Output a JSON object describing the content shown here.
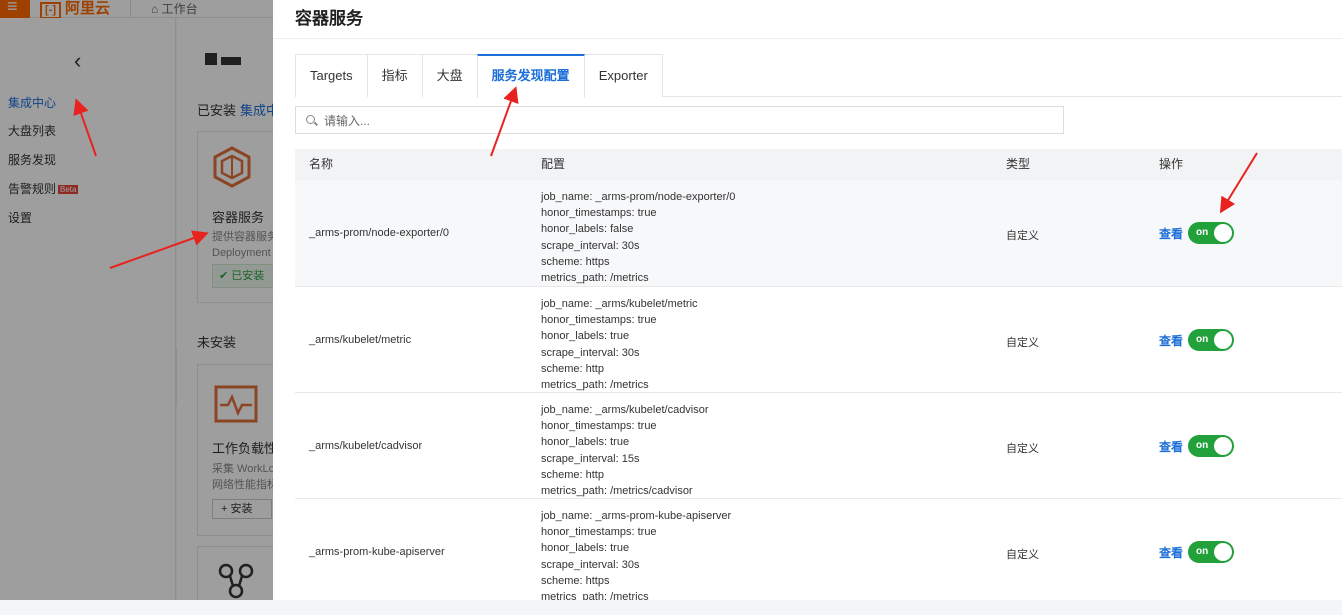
{
  "topbar": {
    "logo_text": "阿里云",
    "logo_mark": "[-]",
    "workbench": "⌂ 工作台"
  },
  "leftnav": {
    "items": [
      {
        "label": "集成中心",
        "active": true
      },
      {
        "label": "大盘列表"
      },
      {
        "label": "服务发现"
      },
      {
        "label": "告警规则",
        "badge": "Beta"
      },
      {
        "label": "设置"
      }
    ]
  },
  "center": {
    "installed_title": "已安装",
    "installed_link": "集成中",
    "uninstalled_title": "未安装",
    "card_container": {
      "name": "容器服务",
      "desc_line1": "提供容器服务",
      "desc_line2": "Deployment",
      "status": "✔ 已安装"
    },
    "card_workload": {
      "name": "工作负载性",
      "desc_line1": "采集 WorkLo",
      "desc_line2": "网络性能指标",
      "install": "+ 安装"
    }
  },
  "drawer": {
    "title": "容器服务",
    "tabs": [
      {
        "label": "Targets"
      },
      {
        "label": "指标"
      },
      {
        "label": "大盘"
      },
      {
        "label": "服务发现配置",
        "active": true
      },
      {
        "label": "Exporter"
      }
    ],
    "search_placeholder": "请输入...",
    "table": {
      "headers": {
        "name": "名称",
        "config": "配置",
        "type": "类型",
        "action": "操作"
      },
      "rows": [
        {
          "name": "_arms-prom/node-exporter/0",
          "config": [
            "job_name: _arms-prom/node-exporter/0",
            "honor_timestamps: true",
            "honor_labels: false",
            "scrape_interval: 30s",
            "scheme: https",
            "metrics_path: /metrics"
          ],
          "type": "自定义",
          "view": "查看",
          "toggle": "on"
        },
        {
          "name": "_arms/kubelet/metric",
          "config": [
            "job_name: _arms/kubelet/metric",
            "honor_timestamps: true",
            "honor_labels: true",
            "scrape_interval: 30s",
            "scheme: http",
            "metrics_path: /metrics"
          ],
          "type": "自定义",
          "view": "查看",
          "toggle": "on"
        },
        {
          "name": "_arms/kubelet/cadvisor",
          "config": [
            "job_name: _arms/kubelet/cadvisor",
            "honor_timestamps: true",
            "honor_labels: true",
            "scrape_interval: 15s",
            "scheme: http",
            "metrics_path: /metrics/cadvisor"
          ],
          "type": "自定义",
          "view": "查看",
          "toggle": "on"
        },
        {
          "name": "_arms-prom-kube-apiserver",
          "config": [
            "job_name: _arms-prom-kube-apiserver",
            "honor_timestamps: true",
            "honor_labels: true",
            "scrape_interval: 30s",
            "scheme: https",
            "metrics_path: /metrics"
          ],
          "type": "自定义",
          "view": "查看",
          "toggle": "on"
        }
      ]
    }
  },
  "colors": {
    "accent": "#1c6fd8",
    "brand": "#ff6a00",
    "toggle_on": "#22a03a",
    "annotation_arrow": "#e8231f"
  }
}
